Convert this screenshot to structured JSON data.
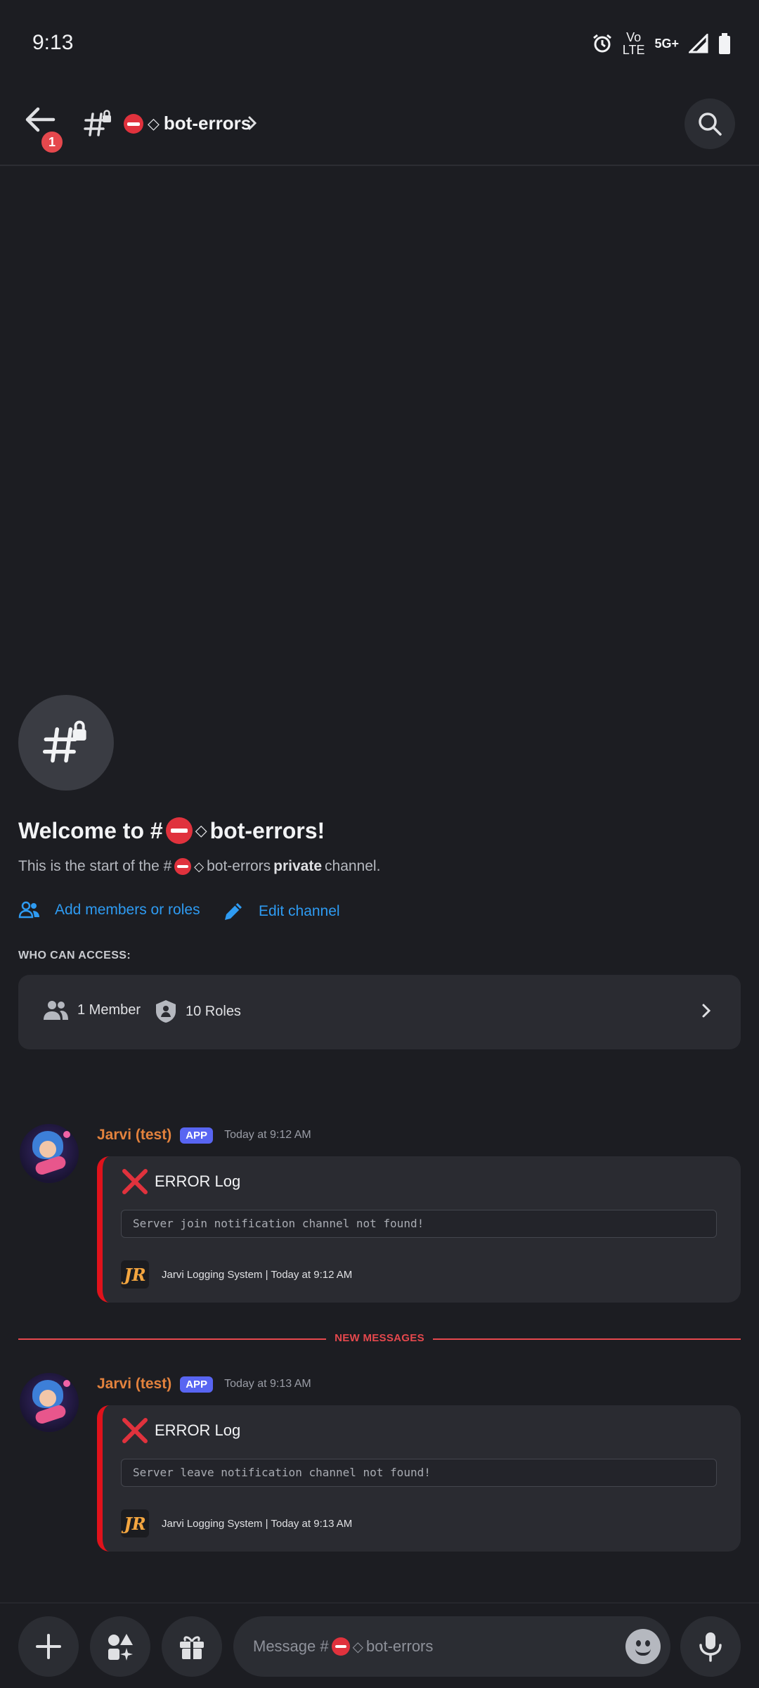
{
  "status_bar": {
    "time": "9:13",
    "volte_top": "Vo",
    "volte_bottom": "LTE",
    "network": "5G+"
  },
  "header": {
    "back_badge_count": "1",
    "channel_name": "bot-errors"
  },
  "welcome": {
    "title_prefix": "Welcome to #",
    "title_name": "bot-errors!",
    "sub_prefix": "This is the start of the #",
    "sub_name": "bot-errors",
    "sub_bold": "private",
    "sub_suffix": "channel.",
    "add_members_label": "Add members or roles",
    "edit_channel_label": "Edit channel",
    "who_can_access_label": "WHO CAN ACCESS:",
    "members_label": "1 Member",
    "roles_label": "10 Roles"
  },
  "messages": [
    {
      "author": "Jarvi (test)",
      "tag": "APP",
      "timestamp": "Today at 9:12 AM",
      "embed_title": "ERROR Log",
      "embed_code": "Server join notification channel not found!",
      "embed_footer": "Jarvi Logging System | Today at 9:12 AM",
      "footer_logo": "JR"
    },
    {
      "author": "Jarvi (test)",
      "tag": "APP",
      "timestamp": "Today at 9:13 AM",
      "embed_title": "ERROR Log",
      "embed_code": "Server leave notification channel not found!",
      "embed_footer": "Jarvi Logging System | Today at 9:13 AM",
      "footer_logo": "JR"
    }
  ],
  "divider_label": "NEW MESSAGES",
  "composer": {
    "placeholder_prefix": "Message #",
    "placeholder_name": "bot-errors"
  },
  "colors": {
    "background": "#1c1d22",
    "link": "#2e9bf2",
    "author": "#e3823d",
    "app_tag": "#5865f2",
    "embed_accent": "#e0121b",
    "new_messages": "#e5484d"
  },
  "icons": {
    "channel_badge": "red-no-entry-icon",
    "diamond": "diamond-outline-icon"
  }
}
